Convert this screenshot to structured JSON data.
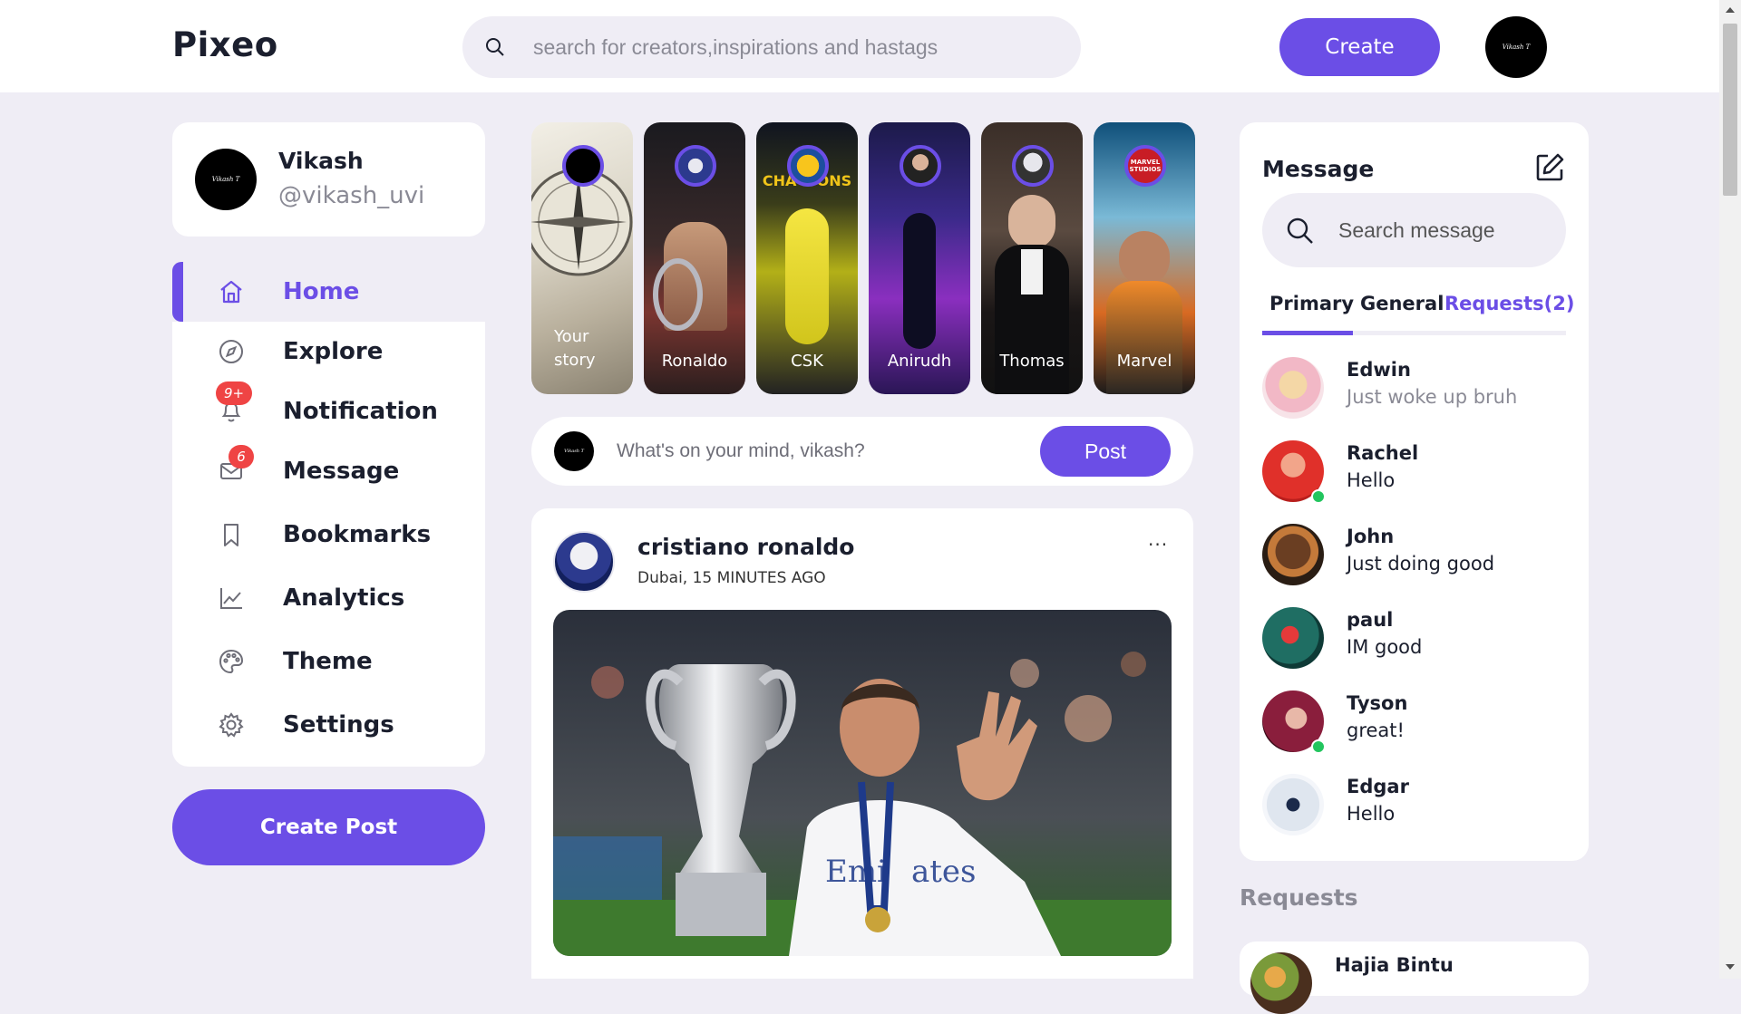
{
  "app": {
    "name": "Pixeo",
    "accent": "#6b4ee6"
  },
  "topbar": {
    "search_placeholder": "search for creators,inspirations and hastags",
    "create_label": "Create",
    "avatar_text": "Vikash T"
  },
  "profile": {
    "name": "Vikash",
    "handle": "@vikash_uvi"
  },
  "sidebar": {
    "items": [
      {
        "label": "Home",
        "icon": "home-icon",
        "active": true
      },
      {
        "label": "Explore",
        "icon": "compass-icon"
      },
      {
        "label": "Notification",
        "icon": "bell-icon",
        "badge": "9+"
      },
      {
        "label": "Message",
        "icon": "mail-icon",
        "badge": "6"
      },
      {
        "label": "Bookmarks",
        "icon": "bookmark-icon"
      },
      {
        "label": "Analytics",
        "icon": "chart-line-icon"
      },
      {
        "label": "Theme",
        "icon": "palette-icon"
      },
      {
        "label": "Settings",
        "icon": "gear-icon"
      }
    ],
    "create_post_label": "Create Post"
  },
  "stories": [
    {
      "label": "Your story"
    },
    {
      "label": "Ronaldo"
    },
    {
      "label": "CSK"
    },
    {
      "label": "Anirudh"
    },
    {
      "label": "Thomas"
    },
    {
      "label": "Marvel"
    }
  ],
  "composer": {
    "placeholder": "What's on your mind, vikash?",
    "post_label": "Post"
  },
  "feed": {
    "author": "cristiano ronaldo",
    "meta": "Dubai, 15 MINUTES AGO",
    "more_label": "..."
  },
  "messages": {
    "title": "Message",
    "search_placeholder": "Search message",
    "tabs": {
      "primary": "Primary",
      "general": "General",
      "requests": "Requests(2)"
    },
    "chats": [
      {
        "name": "Edwin",
        "message": "Just woke up bruh",
        "online": false,
        "muted": true
      },
      {
        "name": "Rachel",
        "message": "Hello",
        "online": true
      },
      {
        "name": "John",
        "message": "Just doing good",
        "online": false
      },
      {
        "name": "paul",
        "message": "IM good",
        "online": false
      },
      {
        "name": "Tyson",
        "message": "great!",
        "online": true
      },
      {
        "name": "Edgar",
        "message": "Hello",
        "online": false
      }
    ]
  },
  "requests": {
    "title": "Requests",
    "items": [
      {
        "name": "Hajia Bintu"
      }
    ]
  }
}
